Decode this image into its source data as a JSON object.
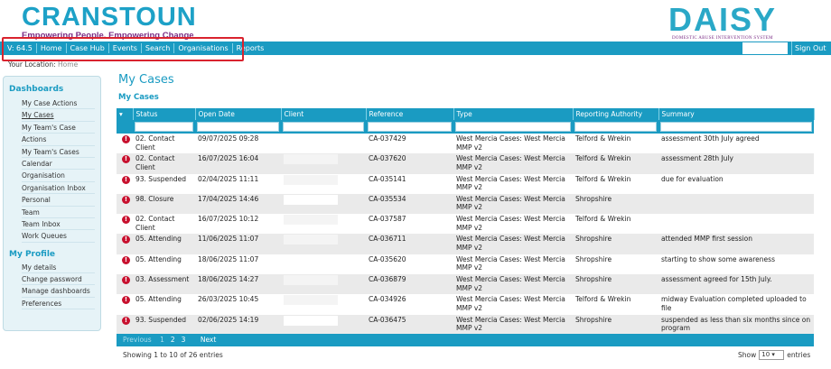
{
  "header": {
    "brand": "CRANSTOUN",
    "tagline": "Empowering People. Empowering Change",
    "product": "DAISY",
    "product_sub": "DOMESTIC ABUSE INTERVENTION SYSTEM"
  },
  "nav": {
    "items": [
      "V: 64.5",
      "Home",
      "Case Hub",
      "Events",
      "Search",
      "Organisations",
      "Reports"
    ],
    "sign_out": "Sign Out"
  },
  "location": {
    "label": "Your Location:",
    "value": "Home"
  },
  "sidebar": {
    "dashboards_title": "Dashboards",
    "dashboards": [
      "My Case Actions",
      "My Cases",
      "My Team's Case",
      "Actions",
      "My Team's Cases",
      "Calendar",
      "Organisation",
      "Organisation Inbox",
      "Personal",
      "Team",
      "Team Inbox",
      "Work Queues"
    ],
    "profile_title": "My Profile",
    "profile": [
      "My details",
      "Change password",
      "Manage dashboards",
      "Preferences"
    ]
  },
  "main": {
    "title": "My Cases",
    "subtitle": "My Cases"
  },
  "table": {
    "columns": [
      "Status",
      "Open Date",
      "Client",
      "Reference",
      "Type",
      "Reporting Authority",
      "Summary"
    ],
    "rows": [
      {
        "status": "02. Contact Client",
        "date": "09/07/2025 09:28",
        "ref": "CA-037429",
        "type": "West Mercia Cases: West Mercia MMP v2",
        "auth": "Telford & Wrekin",
        "summary": "assessment 30th July agreed"
      },
      {
        "status": "02. Contact Client",
        "date": "16/07/2025 16:04",
        "ref": "CA-037620",
        "type": "West Mercia Cases: West Mercia MMP v2",
        "auth": "Telford & Wrekin",
        "summary": "assessment 28th July"
      },
      {
        "status": "93. Suspended",
        "date": "02/04/2025 11:11",
        "ref": "CA-035141",
        "type": "West Mercia Cases: West Mercia MMP v2",
        "auth": "Telford & Wrekin",
        "summary": "due for evaluation"
      },
      {
        "status": "98. Closure",
        "date": "17/04/2025 14:46",
        "ref": "CA-035534",
        "type": "West Mercia Cases: West Mercia MMP v2",
        "auth": "Shropshire",
        "summary": ""
      },
      {
        "status": "02. Contact Client",
        "date": "16/07/2025 10:12",
        "ref": "CA-037587",
        "type": "West Mercia Cases: West Mercia MMP v2",
        "auth": "Telford & Wrekin",
        "summary": ""
      },
      {
        "status": "05. Attending",
        "date": "11/06/2025 11:07",
        "ref": "CA-036711",
        "type": "West Mercia Cases: West Mercia MMP v2",
        "auth": "Shropshire",
        "summary": "attended MMP first session"
      },
      {
        "status": "05. Attending",
        "date": "18/06/2025 11:07",
        "ref": "CA-035620",
        "type": "West Mercia Cases: West Mercia MMP v2",
        "auth": "Shropshire",
        "summary": "starting to show some awareness"
      },
      {
        "status": "03. Assessment",
        "date": "18/06/2025 14:27",
        "ref": "CA-036879",
        "type": "West Mercia Cases: West Mercia MMP v2",
        "auth": "Shropshire",
        "summary": "assessment agreed for 15th July."
      },
      {
        "status": "05. Attending",
        "date": "26/03/2025 10:45",
        "ref": "CA-034926",
        "type": "West Mercia Cases: West Mercia MMP v2",
        "auth": "Telford & Wrekin",
        "summary": "midway Evaluation completed uploaded to file"
      },
      {
        "status": "93. Suspended",
        "date": "02/06/2025 14:19",
        "ref": "CA-036475",
        "type": "West Mercia Cases: West Mercia MMP v2",
        "auth": "Shropshire",
        "summary": "suspended as less than six months since on program"
      }
    ]
  },
  "pager": {
    "previous": "Previous",
    "pages": [
      "1",
      "2",
      "3"
    ],
    "next": "Next"
  },
  "footer": {
    "showing": "Showing 1 to 10 of 26 entries",
    "show_label": "Show",
    "show_value": "10",
    "entries_label": "entries"
  }
}
